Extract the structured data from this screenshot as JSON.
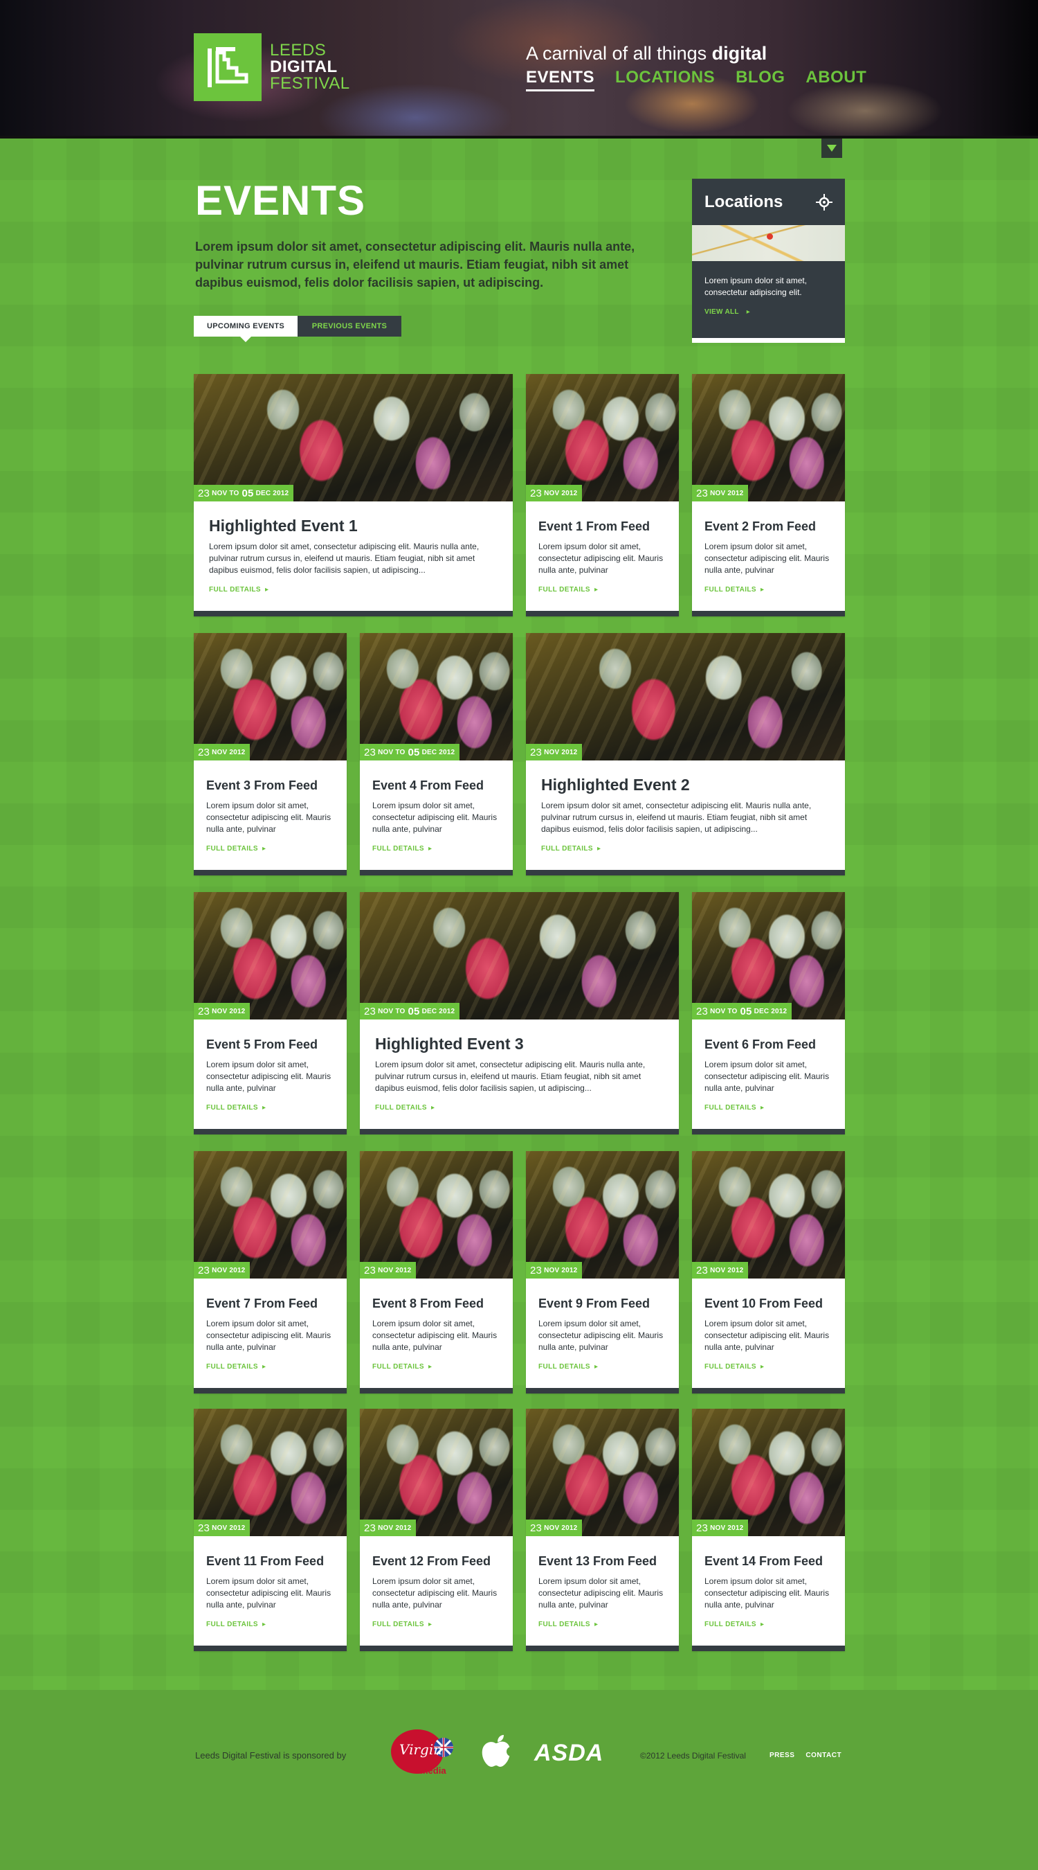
{
  "header": {
    "logo": {
      "line1": "LEEDS",
      "line2": "DIGITAL",
      "line3": "FESTIVAL"
    },
    "tagline_pre": "A carnival of all things",
    "tagline_bold": "digital",
    "nav": [
      {
        "label": "EVENTS",
        "active": true
      },
      {
        "label": "LOCATIONS",
        "active": false
      },
      {
        "label": "BLOG",
        "active": false
      },
      {
        "label": "ABOUT",
        "active": false
      }
    ]
  },
  "main": {
    "title": "EVENTS",
    "intro": "Lorem ipsum dolor sit amet, consectetur adipiscing elit. Mauris nulla ante, pulvinar rutrum cursus in, eleifend ut mauris. Etiam feugiat, nibh sit amet dapibus euismod, felis dolor facilisis sapien, ut adipiscing.",
    "tabs": [
      {
        "label": "UPCOMING EVENTS",
        "active": true
      },
      {
        "label": "PREVIOUS EVENTS",
        "active": false
      }
    ]
  },
  "locations": {
    "title": "Locations",
    "text": "Lorem ipsum dolor sit amet, consectetur adipiscing elit.",
    "link": "VIEW ALL"
  },
  "events": [
    {
      "title": "Highlighted Event 1",
      "day": "23",
      "month": "NOV",
      "to_label": "TO",
      "end_day": "05",
      "end_month": "DEC",
      "year": "2012",
      "text": "Lorem ipsum dolor sit amet, consectetur adipiscing elit. Mauris nulla ante, pulvinar rutrum cursus in, eleifend ut mauris. Etiam feugiat, nibh sit amet dapibus euismod, felis dolor facilisis sapien, ut adipiscing...",
      "link": "FULL DETAILS"
    },
    {
      "title": "Event 1 From Feed",
      "day": "23",
      "month": "NOV",
      "year": "2012",
      "text": "Lorem ipsum dolor sit amet, consectetur adipiscing elit. Mauris nulla ante, pulvinar",
      "link": "FULL DETAILS"
    },
    {
      "title": "Event 2 From Feed",
      "day": "23",
      "month": "NOV",
      "year": "2012",
      "text": "Lorem ipsum dolor sit amet, consectetur adipiscing elit. Mauris nulla ante, pulvinar",
      "link": "FULL DETAILS"
    },
    {
      "title": "Event 3 From Feed",
      "day": "23",
      "month": "NOV",
      "year": "2012",
      "text": "Lorem ipsum dolor sit amet, consectetur adipiscing elit. Mauris nulla ante, pulvinar",
      "link": "FULL DETAILS"
    },
    {
      "title": "Event 4 From Feed",
      "day": "23",
      "month": "NOV",
      "to_label": "TO",
      "end_day": "05",
      "end_month": "DEC",
      "year": "2012",
      "text": "Lorem ipsum dolor sit amet, consectetur adipiscing elit. Mauris nulla ante, pulvinar",
      "link": "FULL DETAILS"
    },
    {
      "title": "Highlighted Event 2",
      "day": "23",
      "month": "NOV",
      "year": "2012",
      "text": "Lorem ipsum dolor sit amet, consectetur adipiscing elit. Mauris nulla ante, pulvinar rutrum cursus in, eleifend ut mauris. Etiam feugiat, nibh sit amet dapibus euismod, felis dolor facilisis sapien, ut adipiscing...",
      "link": "FULL DETAILS"
    },
    {
      "title": "Event 5 From Feed",
      "day": "23",
      "month": "NOV",
      "year": "2012",
      "text": "Lorem ipsum dolor sit amet, consectetur adipiscing elit. Mauris nulla ante, pulvinar",
      "link": "FULL DETAILS"
    },
    {
      "title": "Highlighted Event 3",
      "day": "23",
      "month": "NOV",
      "to_label": "TO",
      "end_day": "05",
      "end_month": "DEC",
      "year": "2012",
      "text": "Lorem ipsum dolor sit amet, consectetur adipiscing elit. Mauris nulla ante, pulvinar rutrum cursus in, eleifend ut mauris. Etiam feugiat, nibh sit amet dapibus euismod, felis dolor facilisis sapien, ut adipiscing...",
      "link": "FULL DETAILS"
    },
    {
      "title": "Event 6 From Feed",
      "day": "23",
      "month": "NOV",
      "to_label": "TO",
      "end_day": "05",
      "end_month": "DEC",
      "year": "2012",
      "text": "Lorem ipsum dolor sit amet, consectetur adipiscing elit. Mauris nulla ante, pulvinar",
      "link": "FULL DETAILS"
    },
    {
      "title": "Event 7 From Feed",
      "day": "23",
      "month": "NOV",
      "year": "2012",
      "text": "Lorem ipsum dolor sit amet, consectetur adipiscing elit. Mauris nulla ante, pulvinar",
      "link": "FULL DETAILS"
    },
    {
      "title": "Event 8 From Feed",
      "day": "23",
      "month": "NOV",
      "year": "2012",
      "text": "Lorem ipsum dolor sit amet, consectetur adipiscing elit. Mauris nulla ante, pulvinar",
      "link": "FULL DETAILS"
    },
    {
      "title": "Event 9 From Feed",
      "day": "23",
      "month": "NOV",
      "year": "2012",
      "text": "Lorem ipsum dolor sit amet, consectetur adipiscing elit. Mauris nulla ante, pulvinar",
      "link": "FULL DETAILS"
    },
    {
      "title": "Event 10 From Feed",
      "day": "23",
      "month": "NOV",
      "year": "2012",
      "text": "Lorem ipsum dolor sit amet, consectetur adipiscing elit. Mauris nulla ante, pulvinar",
      "link": "FULL DETAILS"
    },
    {
      "title": "Event 11 From Feed",
      "day": "23",
      "month": "NOV",
      "year": "2012",
      "text": "Lorem ipsum dolor sit amet, consectetur adipiscing elit. Mauris nulla ante, pulvinar",
      "link": "FULL DETAILS"
    },
    {
      "title": "Event 12 From Feed",
      "day": "23",
      "month": "NOV",
      "year": "2012",
      "text": "Lorem ipsum dolor sit amet, consectetur adipiscing elit. Mauris nulla ante, pulvinar",
      "link": "FULL DETAILS"
    },
    {
      "title": "Event 13 From Feed",
      "day": "23",
      "month": "NOV",
      "year": "2012",
      "text": "Lorem ipsum dolor sit amet, consectetur adipiscing elit. Mauris nulla ante, pulvinar",
      "link": "FULL DETAILS"
    },
    {
      "title": "Event 14 From Feed",
      "day": "23",
      "month": "NOV",
      "year": "2012",
      "text": "Lorem ipsum dolor sit amet, consectetur adipiscing elit. Mauris nulla ante, pulvinar",
      "link": "FULL DETAILS"
    }
  ],
  "footer": {
    "sponsor_text": "Leeds Digital Festival is sponsored by",
    "sponsors": [
      {
        "name": "Virgin media",
        "icon": "virgin-media-logo",
        "word1": "Virgin",
        "word2": "media"
      },
      {
        "name": "Apple",
        "icon": "apple-logo"
      },
      {
        "name": "ASDA",
        "icon": "asda-logo",
        "text": "ASDA"
      }
    ],
    "copyright": "©2012 Leeds Digital Festival",
    "links": [
      "PRESS",
      "CONTACT"
    ]
  },
  "colors": {
    "brand_green": "#6cc43d",
    "background_green": "#67b83f",
    "dark_panel": "#343c42",
    "footer_green": "#5ea53a"
  }
}
